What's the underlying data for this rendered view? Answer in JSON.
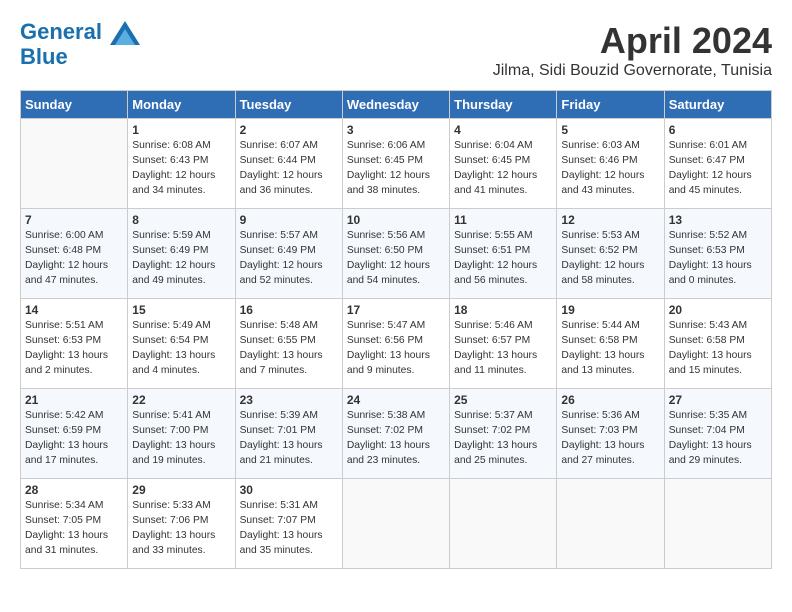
{
  "header": {
    "logo_line1": "General",
    "logo_line2": "Blue",
    "month": "April 2024",
    "location": "Jilma, Sidi Bouzid Governorate, Tunisia"
  },
  "weekdays": [
    "Sunday",
    "Monday",
    "Tuesday",
    "Wednesday",
    "Thursday",
    "Friday",
    "Saturday"
  ],
  "weeks": [
    [
      {
        "day": "",
        "info": ""
      },
      {
        "day": "1",
        "info": "Sunrise: 6:08 AM\nSunset: 6:43 PM\nDaylight: 12 hours\nand 34 minutes."
      },
      {
        "day": "2",
        "info": "Sunrise: 6:07 AM\nSunset: 6:44 PM\nDaylight: 12 hours\nand 36 minutes."
      },
      {
        "day": "3",
        "info": "Sunrise: 6:06 AM\nSunset: 6:45 PM\nDaylight: 12 hours\nand 38 minutes."
      },
      {
        "day": "4",
        "info": "Sunrise: 6:04 AM\nSunset: 6:45 PM\nDaylight: 12 hours\nand 41 minutes."
      },
      {
        "day": "5",
        "info": "Sunrise: 6:03 AM\nSunset: 6:46 PM\nDaylight: 12 hours\nand 43 minutes."
      },
      {
        "day": "6",
        "info": "Sunrise: 6:01 AM\nSunset: 6:47 PM\nDaylight: 12 hours\nand 45 minutes."
      }
    ],
    [
      {
        "day": "7",
        "info": "Sunrise: 6:00 AM\nSunset: 6:48 PM\nDaylight: 12 hours\nand 47 minutes."
      },
      {
        "day": "8",
        "info": "Sunrise: 5:59 AM\nSunset: 6:49 PM\nDaylight: 12 hours\nand 49 minutes."
      },
      {
        "day": "9",
        "info": "Sunrise: 5:57 AM\nSunset: 6:49 PM\nDaylight: 12 hours\nand 52 minutes."
      },
      {
        "day": "10",
        "info": "Sunrise: 5:56 AM\nSunset: 6:50 PM\nDaylight: 12 hours\nand 54 minutes."
      },
      {
        "day": "11",
        "info": "Sunrise: 5:55 AM\nSunset: 6:51 PM\nDaylight: 12 hours\nand 56 minutes."
      },
      {
        "day": "12",
        "info": "Sunrise: 5:53 AM\nSunset: 6:52 PM\nDaylight: 12 hours\nand 58 minutes."
      },
      {
        "day": "13",
        "info": "Sunrise: 5:52 AM\nSunset: 6:53 PM\nDaylight: 13 hours\nand 0 minutes."
      }
    ],
    [
      {
        "day": "14",
        "info": "Sunrise: 5:51 AM\nSunset: 6:53 PM\nDaylight: 13 hours\nand 2 minutes."
      },
      {
        "day": "15",
        "info": "Sunrise: 5:49 AM\nSunset: 6:54 PM\nDaylight: 13 hours\nand 4 minutes."
      },
      {
        "day": "16",
        "info": "Sunrise: 5:48 AM\nSunset: 6:55 PM\nDaylight: 13 hours\nand 7 minutes."
      },
      {
        "day": "17",
        "info": "Sunrise: 5:47 AM\nSunset: 6:56 PM\nDaylight: 13 hours\nand 9 minutes."
      },
      {
        "day": "18",
        "info": "Sunrise: 5:46 AM\nSunset: 6:57 PM\nDaylight: 13 hours\nand 11 minutes."
      },
      {
        "day": "19",
        "info": "Sunrise: 5:44 AM\nSunset: 6:58 PM\nDaylight: 13 hours\nand 13 minutes."
      },
      {
        "day": "20",
        "info": "Sunrise: 5:43 AM\nSunset: 6:58 PM\nDaylight: 13 hours\nand 15 minutes."
      }
    ],
    [
      {
        "day": "21",
        "info": "Sunrise: 5:42 AM\nSunset: 6:59 PM\nDaylight: 13 hours\nand 17 minutes."
      },
      {
        "day": "22",
        "info": "Sunrise: 5:41 AM\nSunset: 7:00 PM\nDaylight: 13 hours\nand 19 minutes."
      },
      {
        "day": "23",
        "info": "Sunrise: 5:39 AM\nSunset: 7:01 PM\nDaylight: 13 hours\nand 21 minutes."
      },
      {
        "day": "24",
        "info": "Sunrise: 5:38 AM\nSunset: 7:02 PM\nDaylight: 13 hours\nand 23 minutes."
      },
      {
        "day": "25",
        "info": "Sunrise: 5:37 AM\nSunset: 7:02 PM\nDaylight: 13 hours\nand 25 minutes."
      },
      {
        "day": "26",
        "info": "Sunrise: 5:36 AM\nSunset: 7:03 PM\nDaylight: 13 hours\nand 27 minutes."
      },
      {
        "day": "27",
        "info": "Sunrise: 5:35 AM\nSunset: 7:04 PM\nDaylight: 13 hours\nand 29 minutes."
      }
    ],
    [
      {
        "day": "28",
        "info": "Sunrise: 5:34 AM\nSunset: 7:05 PM\nDaylight: 13 hours\nand 31 minutes."
      },
      {
        "day": "29",
        "info": "Sunrise: 5:33 AM\nSunset: 7:06 PM\nDaylight: 13 hours\nand 33 minutes."
      },
      {
        "day": "30",
        "info": "Sunrise: 5:31 AM\nSunset: 7:07 PM\nDaylight: 13 hours\nand 35 minutes."
      },
      {
        "day": "",
        "info": ""
      },
      {
        "day": "",
        "info": ""
      },
      {
        "day": "",
        "info": ""
      },
      {
        "day": "",
        "info": ""
      }
    ]
  ]
}
